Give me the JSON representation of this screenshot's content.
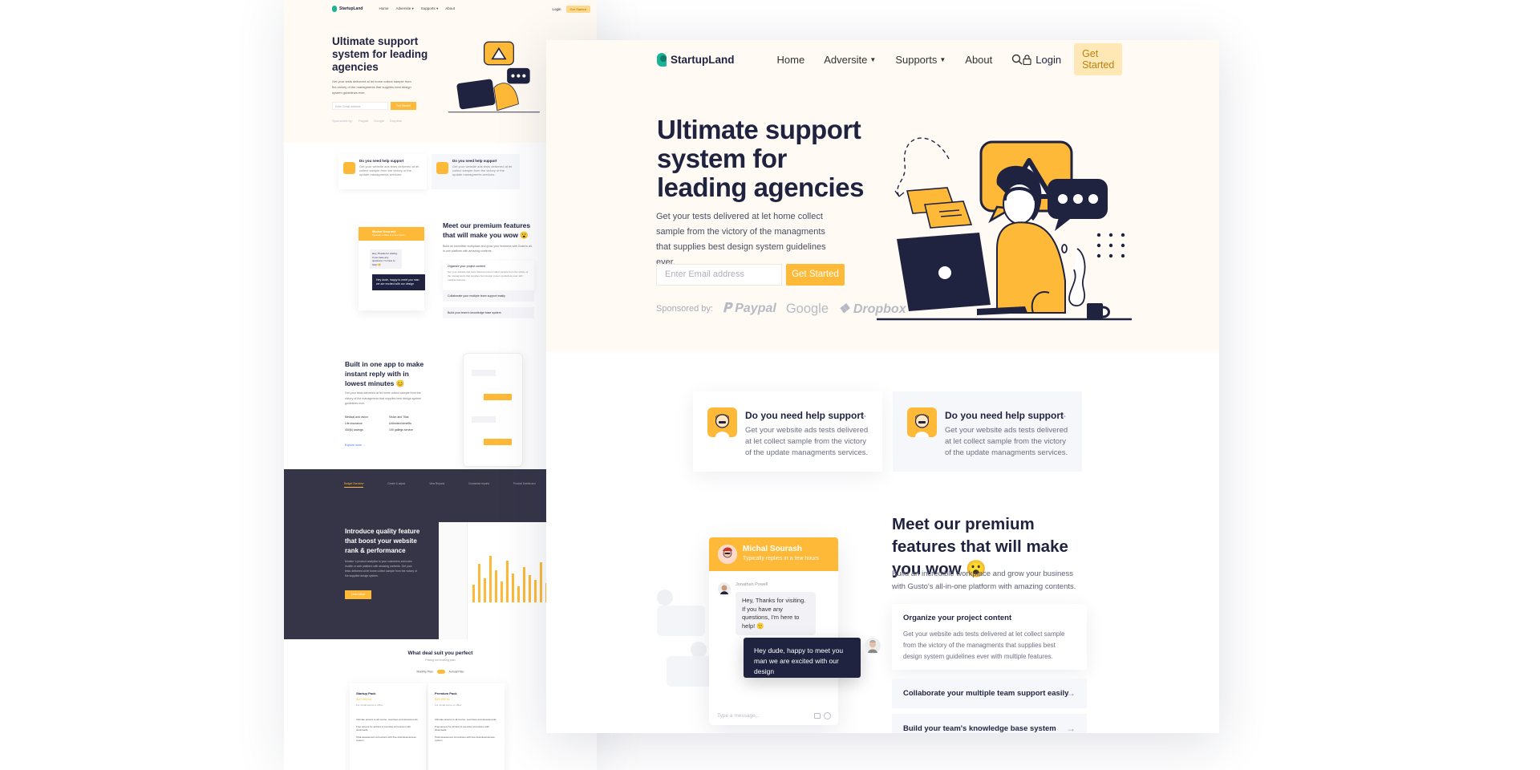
{
  "back": {
    "nav": {
      "logo": "StartupLand",
      "links": [
        "Home",
        "Adversite ▾",
        "Supports ▾",
        "About"
      ],
      "login": "Login",
      "cta": "Get Started"
    },
    "hero": {
      "title": "Ultimate support system for leading agencies",
      "text": "Get your tests delivered at let home collect sample from the victory of the managments that supplies best design system guidelines ever.",
      "email_placeholder": "Enter Email address",
      "cta": "Get Started",
      "sponsored": [
        "Sponsored by:",
        "Paypal",
        "Google",
        "Dropbox"
      ]
    },
    "cards": [
      {
        "title": "Do you need help support",
        "desc": "Get your website ads tests delivered at let collect sample from the victory of the update managments services."
      },
      {
        "title": "Do you need help support",
        "desc": "Get your website ads tests delivered at let collect sample from the victory of the update managments services."
      }
    ],
    "features": {
      "title": "Meet our premium features that will make you wow 😮",
      "desc": "Build an incredible workplace and grow your business with Gusto's all-in-one platform with amazing contents.",
      "acc_open_title": "Organize your project content",
      "acc_open_desc": "Get your website ads tests delivered at let collect sample from the victory of the managments that supplies best design system guidelines ever with multiple features.",
      "acc": [
        "Collaborate your multiple team support easily",
        "Build your team's knowledge base system"
      ],
      "chat_name": "Michal Sourash",
      "chat_status": "Typically replies in a few hours",
      "chat_msg": "Hey, Thanks for visiting. If you have any questions, I'm here to help! 🙂",
      "chat_reply": "Hey dude, happy to meet you man we are excited with our design"
    },
    "app": {
      "title": "Built in one app to make instant reply with in lowest minutes 😊",
      "desc": "Get your tests delivered at let home collect sample from the victory of the managments that supplies best design system guidelines ever.",
      "checks": [
        "Medical and vision",
        "Life insurance",
        "400(k) savings",
        "Vision and Tilas",
        "Unlimited benefits",
        "100 gallegs service"
      ],
      "link": "Explore more →"
    },
    "dark": {
      "tabs": [
        "Budget Overview",
        "Create & adjust",
        "View Reports",
        "Customise reports",
        "Product Dashboard"
      ],
      "title": "Introduce quality feature that boost your website rank & performance",
      "desc": "Monitor 's product analytics to your customers and uses mobile or web platform with amazing contents. Get your tests delivered at let home collect sample from the victory of the supplied design system.",
      "button": "Learn More",
      "bars": [
        22,
        48,
        30,
        58,
        40,
        26,
        52,
        36,
        20,
        44,
        34,
        28,
        50,
        24
      ]
    },
    "pricing": {
      "title": "What deal suit you perfect",
      "subtitle": "Pricing our exciting plan",
      "toggle": [
        "Monthly Plan",
        "Annual Plan"
      ],
      "plans": [
        {
          "name": "Startup Pack",
          "price": "$20.99/mo",
          "desc": "For Small teams or office",
          "items": [
            "Ultimate access to all course, exercises and assessments",
            "Free access for all kind of exercise corrections with downloads.",
            "Total assessment corrections with free download access system"
          ]
        },
        {
          "name": "Premium Pack",
          "price": "$99.99/mo",
          "desc": "For Small teams or office",
          "items": [
            "Ultimate access to all course, exercises and assessments",
            "Free access for all kind of exercise corrections with downloads.",
            "Total assessment corrections with free download access system"
          ]
        }
      ]
    }
  },
  "front": {
    "nav": {
      "logo": "StartupLand",
      "home": "Home",
      "adversite": "Adversite",
      "supports": "Supports",
      "about": "About",
      "login": "Login",
      "get_started": "Get Started"
    },
    "hero": {
      "title": "Ultimate support system for leading agencies",
      "subtitle": "Get your tests delivered at let home collect sample from the victory of the managments that supplies best design system guidelines ever.",
      "email_placeholder": "Enter Email address",
      "cta": "Get Started",
      "sponsored_label": "Sponsored by:",
      "sponsors": [
        "Paypal",
        "Google",
        "Dropbox"
      ]
    },
    "support_cards": [
      {
        "title": "Do you need help support",
        "desc": "Get your website ads tests delivered at let collect sample from the victory of the update managments services."
      },
      {
        "title": "Do you need help support",
        "desc": "Get your website ads tests delivered at let collect sample from the victory of the update managments services."
      }
    ],
    "features": {
      "title": "Meet our premium features that will make you wow 😮",
      "desc": "Build an incredible workplace and grow your business with Gusto's all-in-one platform with amazing contents.",
      "acc_open_title": "Organize your project content",
      "acc_open_desc": "Get your website ads tests delivered at let collect sample from the victory of the managments that supplies best design system guidelines ever with multiple features.",
      "acc_items": [
        "Collaborate your multiple team support easily",
        "Build your team's knowledge base system"
      ]
    },
    "chat": {
      "name": "Michal Sourash",
      "status": "Typically replies in a few hours",
      "sender": "Jonathan Powell",
      "message": "Hey, Thanks for visiting. If you have any questions, I'm here to help! 🙂",
      "reply": "Hey dude, happy to meet you man we are excited with our design",
      "input_placeholder": "Type a message..."
    }
  },
  "colors": {
    "accent": "#ffb938",
    "dark": "#1f2340",
    "hero_bg": "#fffaf3",
    "brand": "#1ab394",
    "panel_dark": "#363548"
  }
}
